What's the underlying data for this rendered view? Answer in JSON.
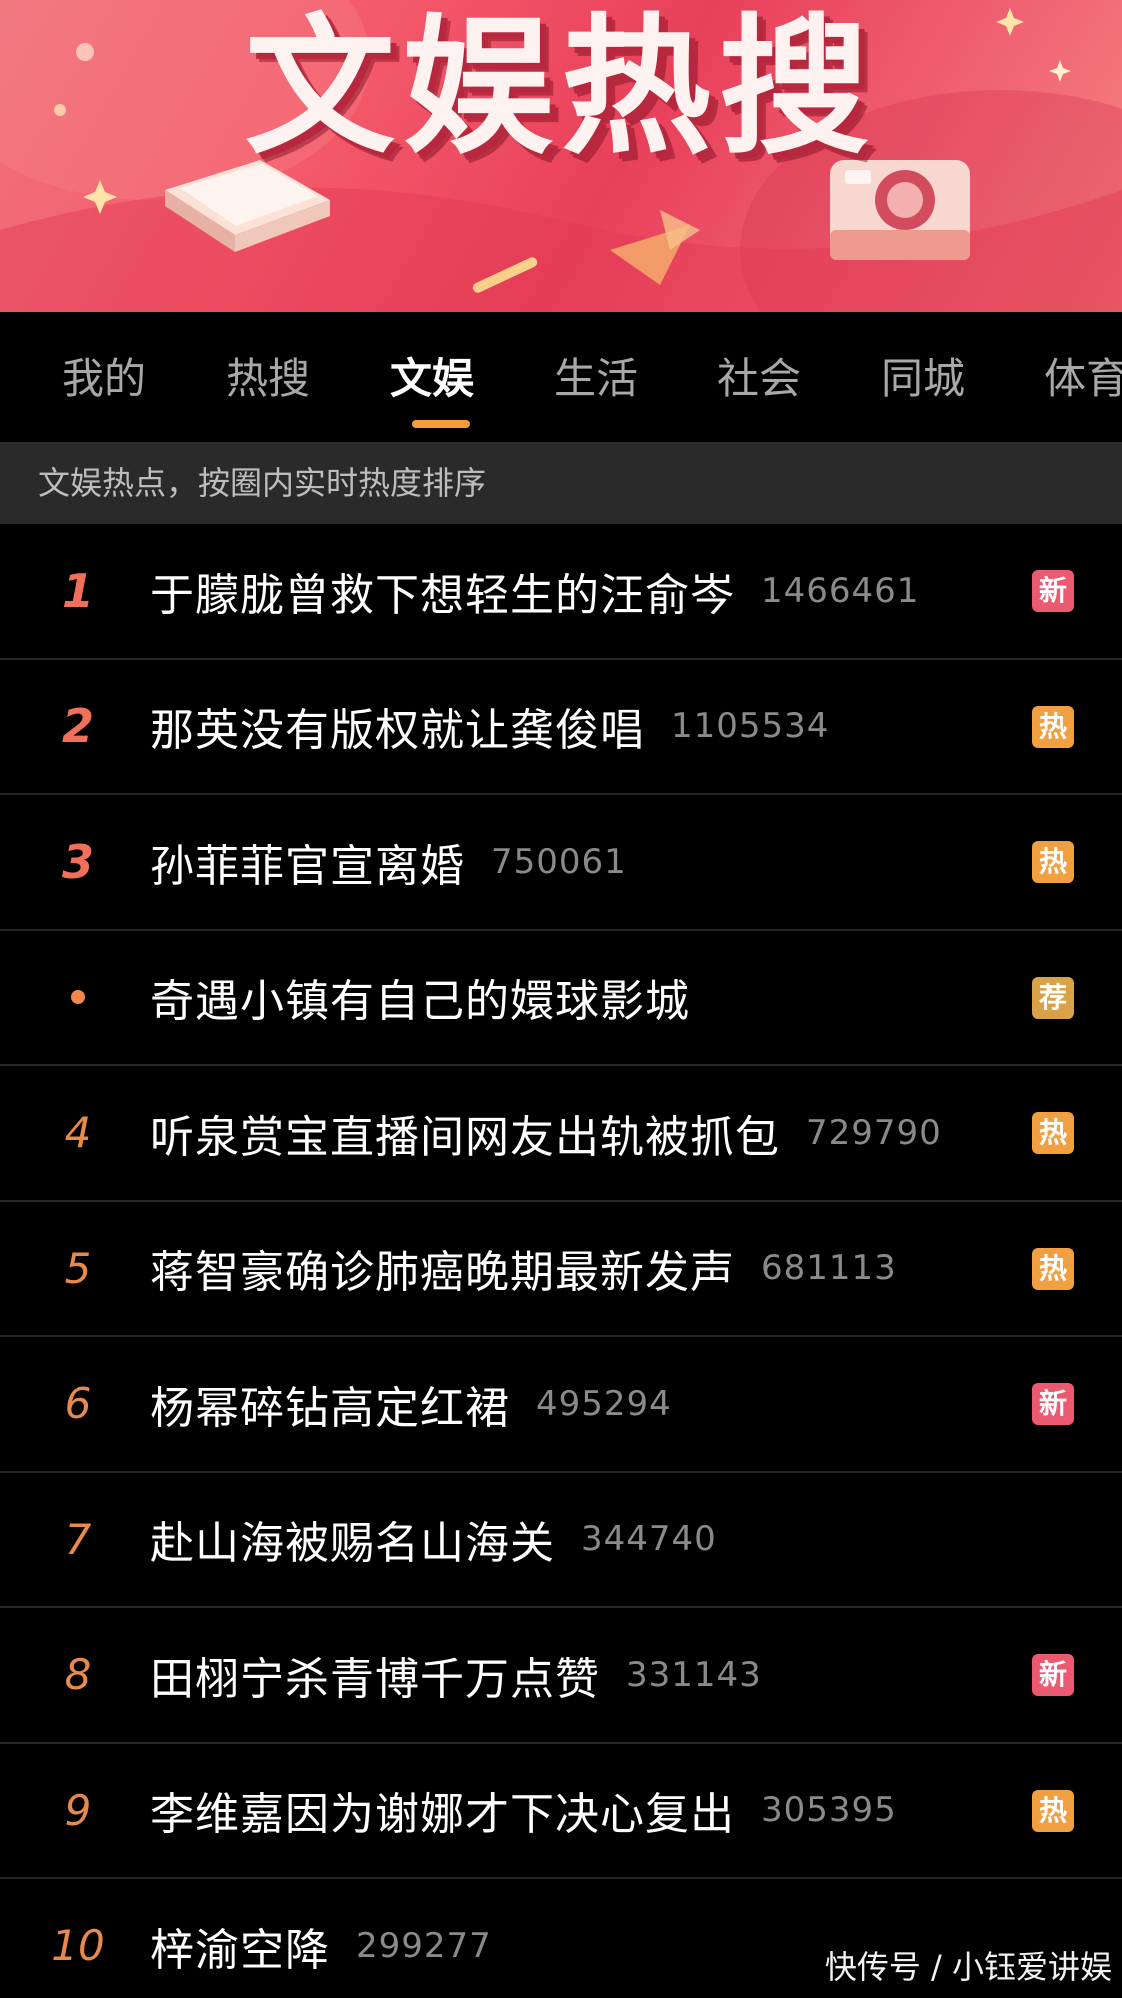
{
  "banner": {
    "title": "文娱热搜"
  },
  "tabs": [
    {
      "label": "我的",
      "active": false
    },
    {
      "label": "热搜",
      "active": false
    },
    {
      "label": "文娱",
      "active": true
    },
    {
      "label": "生活",
      "active": false
    },
    {
      "label": "社会",
      "active": false
    },
    {
      "label": "同城",
      "active": false
    },
    {
      "label": "体育",
      "active": false
    }
  ],
  "subtitle": "文娱热点，按圈内实时热度排序",
  "items": [
    {
      "rank": "1",
      "title": "于朦胧曾救下想轻生的汪俞岑",
      "heat": "1466461",
      "badge": "新",
      "badge_type": "new"
    },
    {
      "rank": "2",
      "title": "那英没有版权就让龚俊唱",
      "heat": "1105534",
      "badge": "热",
      "badge_type": "hot"
    },
    {
      "rank": "3",
      "title": "孙菲菲官宣离婚",
      "heat": "750061",
      "badge": "热",
      "badge_type": "hot"
    },
    {
      "rank": "",
      "title": "奇遇小镇有自己的嬛球影城",
      "heat": "",
      "badge": "荐",
      "badge_type": "rec"
    },
    {
      "rank": "4",
      "title": "听泉赏宝直播间网友出轨被抓包",
      "heat": "729790",
      "badge": "热",
      "badge_type": "hot"
    },
    {
      "rank": "5",
      "title": "蒋智豪确诊肺癌晚期最新发声",
      "heat": "681113",
      "badge": "热",
      "badge_type": "hot"
    },
    {
      "rank": "6",
      "title": "杨幂碎钻高定红裙",
      "heat": "495294",
      "badge": "新",
      "badge_type": "new"
    },
    {
      "rank": "7",
      "title": "赴山海被赐名山海关",
      "heat": "344740",
      "badge": "",
      "badge_type": ""
    },
    {
      "rank": "8",
      "title": "田栩宁杀青博千万点赞",
      "heat": "331143",
      "badge": "新",
      "badge_type": "new"
    },
    {
      "rank": "9",
      "title": "李维嘉因为谢娜才下决心复出",
      "heat": "305395",
      "badge": "热",
      "badge_type": "hot"
    },
    {
      "rank": "10",
      "title": "梓渝空降",
      "heat": "299277",
      "badge": "",
      "badge_type": ""
    }
  ],
  "watermark": "快传号 / 小钰爱讲娱",
  "colors": {
    "accent": "#f59b3a",
    "badge_new": "#ec5a72",
    "badge_hot": "#f0a040",
    "badge_rec": "#d9a248",
    "banner": "#e8405a"
  }
}
